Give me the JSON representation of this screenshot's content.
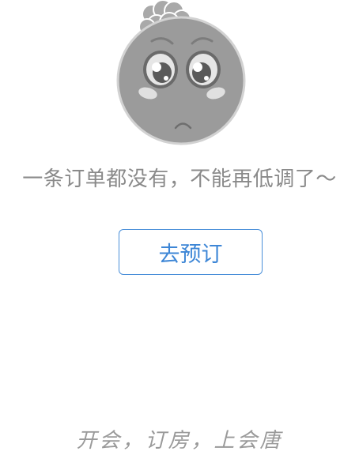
{
  "empty_state": {
    "illustration_icon": "sad-face-icon",
    "message": "一条订单都没有，不能再低调了～"
  },
  "actions": {
    "book_button_label": "去预订"
  },
  "footer": {
    "slogan": "开会，订房，上会唐"
  },
  "colors": {
    "accent": "#3d86d6",
    "text_muted": "#8a8a8a",
    "illustration_gray": "#9b9b9b"
  }
}
